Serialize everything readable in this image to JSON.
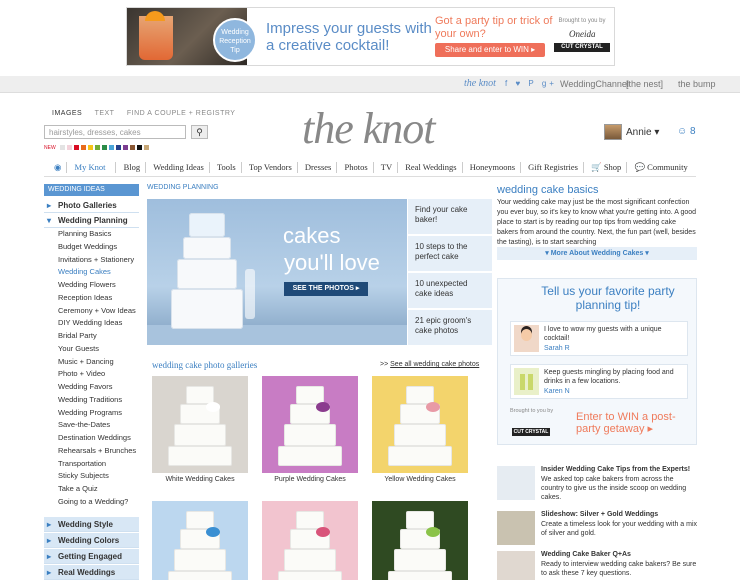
{
  "ad": {
    "badge": "Wedding Reception Tip",
    "headline": "Impress your guests with a creative cocktail!",
    "tip": "Got a party tip or trick of your own?",
    "cta": "Share and enter to WIN ▸",
    "brought_by": "Brought to you by",
    "sponsor_logo": "Oneida",
    "sponsor_name": "CUT CRYSTAL"
  },
  "network": {
    "brand": "the knot",
    "social": "f ♥ P g+",
    "sites": [
      "WeddingChannel",
      "[the nest]",
      "the bump"
    ]
  },
  "header": {
    "search_tabs": [
      "IMAGES",
      "TEXT",
      "FIND A COUPLE + REGISTRY"
    ],
    "search_placeholder": "hairstyles, dresses, cakes",
    "swatch_new": "NEW",
    "swatches": [
      "#e3e3e3",
      "#f3d2da",
      "#d80c23",
      "#e86b1c",
      "#f7c318",
      "#72ac36",
      "#2b8c48",
      "#4aa5d8",
      "#253f8a",
      "#7c3d91",
      "#8a5734",
      "#101010",
      "#c8a877"
    ],
    "logo": "the knot",
    "user": "Annie ▾",
    "notifications": "8"
  },
  "nav": [
    "My Knot",
    "Blog",
    "Wedding Ideas",
    "Tools",
    "Top Vendors",
    "Dresses",
    "Photos",
    "TV",
    "Real Weddings",
    "Honeymoons",
    "Gift Registries",
    "🛒 Shop",
    "💬 Community"
  ],
  "sidebar": {
    "heading": "WEDDING IDEAS",
    "top": [
      {
        "label": "Photo Galleries"
      },
      {
        "label": "Wedding Planning"
      }
    ],
    "subs": [
      "Planning Basics",
      "Budget Weddings",
      "Invitations + Stationery",
      "Wedding Cakes",
      "Wedding Flowers",
      "Reception Ideas",
      "Ceremony + Vow Ideas",
      "DIY Wedding Ideas",
      "Bridal Party",
      "Your Guests",
      "Music + Dancing",
      "Photo + Video",
      "Wedding Favors",
      "Wedding Traditions",
      "Wedding Programs",
      "Save-the-Dates",
      "Destination Weddings",
      "Rehearsals + Brunches",
      "Transportation",
      "Sticky Subjects",
      "Take a Quiz",
      "Going to a Wedding?"
    ],
    "bottom": [
      "Wedding Style",
      "Wedding Colors",
      "Getting Engaged",
      "Real Weddings"
    ]
  },
  "center": {
    "section": "WEDDING PLANNING",
    "hero_line1": "cakes",
    "hero_line2": "you'll love",
    "hero_button": "SEE THE PHOTOS ▸",
    "hero_links": [
      "Find your cake baker!",
      "10 steps to the perfect cake",
      "10 unexpected cake ideas",
      "21 epic groom's cake photos"
    ],
    "gallery_heading": "wedding cake photo galleries",
    "gallery_link": "See all wedding cake photos",
    "gallery_link_prefix": ">>",
    "gallery": [
      {
        "caption": "White Wedding Cakes",
        "bg": "#d9d5cf",
        "accent": "#ffffff"
      },
      {
        "caption": "Purple Wedding Cakes",
        "bg": "#c87cc4",
        "accent": "#8b3c8e"
      },
      {
        "caption": "Yellow Wedding Cakes",
        "bg": "#f3d46c",
        "accent": "#e89aa6"
      },
      {
        "caption": "",
        "bg": "#bcd7ef",
        "accent": "#3a8fd2"
      },
      {
        "caption": "",
        "bg": "#f2c4cf",
        "accent": "#d8547a"
      },
      {
        "caption": "",
        "bg": "#2f4a22",
        "accent": "#8bc34a"
      }
    ]
  },
  "right": {
    "basics_title": "wedding cake basics",
    "basics_text": "Your wedding cake may just be the most significant confection you ever buy, so it's key to know what you're getting into. A good place to start is by reading our top tips from wedding cake bakers from around the country. Next, the fun part (well, besides the tasting), is to start searching",
    "more_link": "▾ More About Wedding Cakes ▾",
    "tip_title": "Tell us your favorite party planning tip!",
    "tips": [
      {
        "text": "I love to wow my guests with a unique cocktail!",
        "author": "Sarah R"
      },
      {
        "text": "Keep guests mingling by placing food and drinks in a few locations.",
        "author": "Karen N"
      }
    ],
    "enter_by": "Brought to you by",
    "enter_sponsor": "CUT CRYSTAL",
    "enter_text": "Enter to WIN a post-party getaway ▸",
    "articles": [
      {
        "title": "Insider Wedding Cake Tips from the Experts!",
        "text": "We asked top cake bakers from across the country to give us the inside scoop on wedding cakes."
      },
      {
        "title": "Slideshow: Silver + Gold Weddings",
        "text": "Create a timeless look for your wedding with a mix of silver and gold."
      },
      {
        "title": "Wedding Cake Baker Q+As",
        "text": "Ready to interview wedding cake bakers? Be sure to ask these 7 key questions."
      }
    ]
  }
}
